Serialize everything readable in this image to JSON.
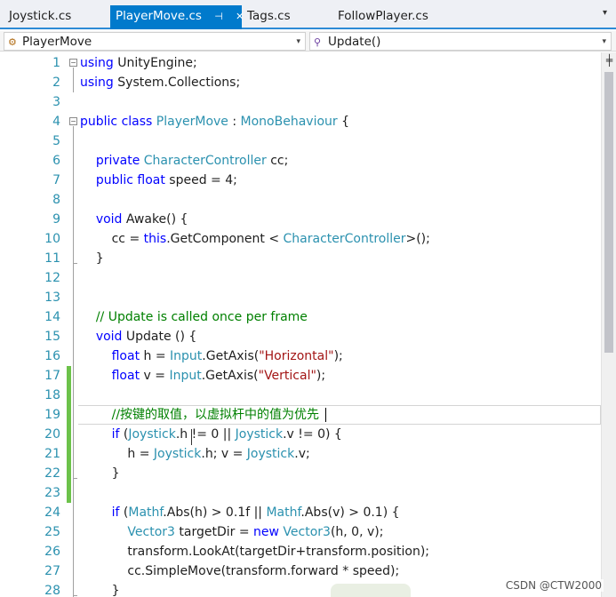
{
  "tabs": [
    {
      "label": "Joystick.cs",
      "active": false
    },
    {
      "label": "PlayerMove.cs",
      "active": true,
      "pin": "⊣",
      "close": "✕"
    },
    {
      "label": "Tags.cs",
      "active": false
    },
    {
      "label": "FollowPlayer.cs",
      "active": false
    }
  ],
  "tab_overflow": "▾",
  "navbar": {
    "class_combo": "PlayerMove",
    "member_combo": "Update()",
    "arrow": "▾"
  },
  "editor": {
    "line_numbers": [
      "1",
      "2",
      "3",
      "4",
      "5",
      "6",
      "7",
      "8",
      "9",
      "10",
      "11",
      "12",
      "13",
      "14",
      "15",
      "16",
      "17",
      "18",
      "19",
      "20",
      "21",
      "22",
      "23",
      "24",
      "25",
      "26",
      "27",
      "28"
    ],
    "lines": [
      [
        {
          "t": "kw",
          "s": "using"
        },
        {
          "t": "",
          "s": " UnityEngine;"
        }
      ],
      [
        {
          "t": "kw",
          "s": "using"
        },
        {
          "t": "",
          "s": " System.Collections;"
        }
      ],
      [],
      [
        {
          "t": "kw",
          "s": "public"
        },
        {
          "t": "",
          "s": " "
        },
        {
          "t": "kw",
          "s": "class"
        },
        {
          "t": "",
          "s": " "
        },
        {
          "t": "ty",
          "s": "PlayerMove"
        },
        {
          "t": "",
          "s": " : "
        },
        {
          "t": "ty",
          "s": "MonoBehaviour"
        },
        {
          "t": "",
          "s": " {"
        }
      ],
      [],
      [
        {
          "t": "",
          "s": "    "
        },
        {
          "t": "kw",
          "s": "private"
        },
        {
          "t": "",
          "s": " "
        },
        {
          "t": "ty",
          "s": "CharacterController"
        },
        {
          "t": "",
          "s": " cc;"
        }
      ],
      [
        {
          "t": "",
          "s": "    "
        },
        {
          "t": "kw",
          "s": "public"
        },
        {
          "t": "",
          "s": " "
        },
        {
          "t": "kw",
          "s": "float"
        },
        {
          "t": "",
          "s": " speed = 4;"
        }
      ],
      [],
      [
        {
          "t": "",
          "s": "    "
        },
        {
          "t": "kw",
          "s": "void"
        },
        {
          "t": "",
          "s": " Awake() {"
        }
      ],
      [
        {
          "t": "",
          "s": "        cc = "
        },
        {
          "t": "kw",
          "s": "this"
        },
        {
          "t": "",
          "s": ".GetComponent < "
        },
        {
          "t": "ty",
          "s": "CharacterController"
        },
        {
          "t": "",
          "s": ">();"
        }
      ],
      [
        {
          "t": "",
          "s": "    }"
        }
      ],
      [],
      [],
      [
        {
          "t": "",
          "s": "    "
        },
        {
          "t": "cm",
          "s": "// Update is called once per frame"
        }
      ],
      [
        {
          "t": "",
          "s": "    "
        },
        {
          "t": "kw",
          "s": "void"
        },
        {
          "t": "",
          "s": " Update () {"
        }
      ],
      [
        {
          "t": "",
          "s": "        "
        },
        {
          "t": "kw",
          "s": "float"
        },
        {
          "t": "",
          "s": " h = "
        },
        {
          "t": "ty",
          "s": "Input"
        },
        {
          "t": "",
          "s": ".GetAxis("
        },
        {
          "t": "str",
          "s": "\"Horizontal\""
        },
        {
          "t": "",
          "s": ");"
        }
      ],
      [
        {
          "t": "",
          "s": "        "
        },
        {
          "t": "kw",
          "s": "float"
        },
        {
          "t": "",
          "s": " v = "
        },
        {
          "t": "ty",
          "s": "Input"
        },
        {
          "t": "",
          "s": ".GetAxis("
        },
        {
          "t": "str",
          "s": "\"Vertical\""
        },
        {
          "t": "",
          "s": ");"
        }
      ],
      [],
      [
        {
          "t": "",
          "s": "        "
        },
        {
          "t": "cm",
          "s": "//按键的取值，以虚拟杆中的值为优先"
        }
      ],
      [
        {
          "t": "",
          "s": "        "
        },
        {
          "t": "kw",
          "s": "if"
        },
        {
          "t": "",
          "s": " ("
        },
        {
          "t": "ty",
          "s": "Joystick"
        },
        {
          "t": "",
          "s": ".h != 0 || "
        },
        {
          "t": "ty",
          "s": "Joystick"
        },
        {
          "t": "",
          "s": ".v != 0) {"
        }
      ],
      [
        {
          "t": "",
          "s": "            h = "
        },
        {
          "t": "ty",
          "s": "Joystick"
        },
        {
          "t": "",
          "s": ".h; v = "
        },
        {
          "t": "ty",
          "s": "Joystick"
        },
        {
          "t": "",
          "s": ".v;"
        }
      ],
      [
        {
          "t": "",
          "s": "        }"
        }
      ],
      [],
      [
        {
          "t": "",
          "s": "        "
        },
        {
          "t": "kw",
          "s": "if"
        },
        {
          "t": "",
          "s": " ("
        },
        {
          "t": "ty",
          "s": "Mathf"
        },
        {
          "t": "",
          "s": ".Abs(h) > 0.1f || "
        },
        {
          "t": "ty",
          "s": "Mathf"
        },
        {
          "t": "",
          "s": ".Abs(v) > 0.1) {"
        }
      ],
      [
        {
          "t": "",
          "s": "            "
        },
        {
          "t": "ty",
          "s": "Vector3"
        },
        {
          "t": "",
          "s": " targetDir = "
        },
        {
          "t": "kw",
          "s": "new"
        },
        {
          "t": "",
          "s": " "
        },
        {
          "t": "ty",
          "s": "Vector3"
        },
        {
          "t": "",
          "s": "(h, 0, v);"
        }
      ],
      [
        {
          "t": "",
          "s": "            transform.LookAt(targetDir+transform.position);"
        }
      ],
      [
        {
          "t": "",
          "s": "            cc.SimpleMove(transform.forward * speed);"
        }
      ],
      [
        {
          "t": "",
          "s": "        }"
        }
      ]
    ]
  },
  "scrollbar_split": "╪",
  "watermark": "CSDN @CTW2000",
  "colors": {
    "keyword": "#0000ff",
    "type": "#2b91af",
    "string": "#a31515",
    "comment": "#008000",
    "accent": "#007acc",
    "change": "#6cc24a"
  }
}
